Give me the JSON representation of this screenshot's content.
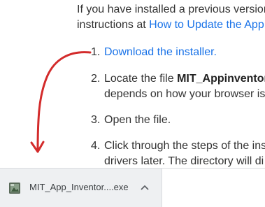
{
  "intro": {
    "line1": "If you have installed a previous version",
    "line2_prefix": "instructions at ",
    "line2_link": "How to Update the App"
  },
  "steps": [
    {
      "number": "1.",
      "link": "Download the installer."
    },
    {
      "number": "2.",
      "text_prefix": "Locate the file ",
      "bold": "MIT_Appinventor_",
      "line2": "depends on how your browser is"
    },
    {
      "number": "3.",
      "text": "Open the file."
    },
    {
      "number": "4.",
      "text": "Click through the steps of the ins",
      "line2": "drivers later. The directory will di"
    }
  ],
  "download_bar": {
    "file_name": "MIT_App_Inventor....exe",
    "file_icon": "installer-file-icon",
    "menu_icon": "chevron-up-icon"
  },
  "colors": {
    "link": "#1a73e8",
    "arrow": "#d32b2b",
    "download_item_bg": "#eef0f2"
  }
}
